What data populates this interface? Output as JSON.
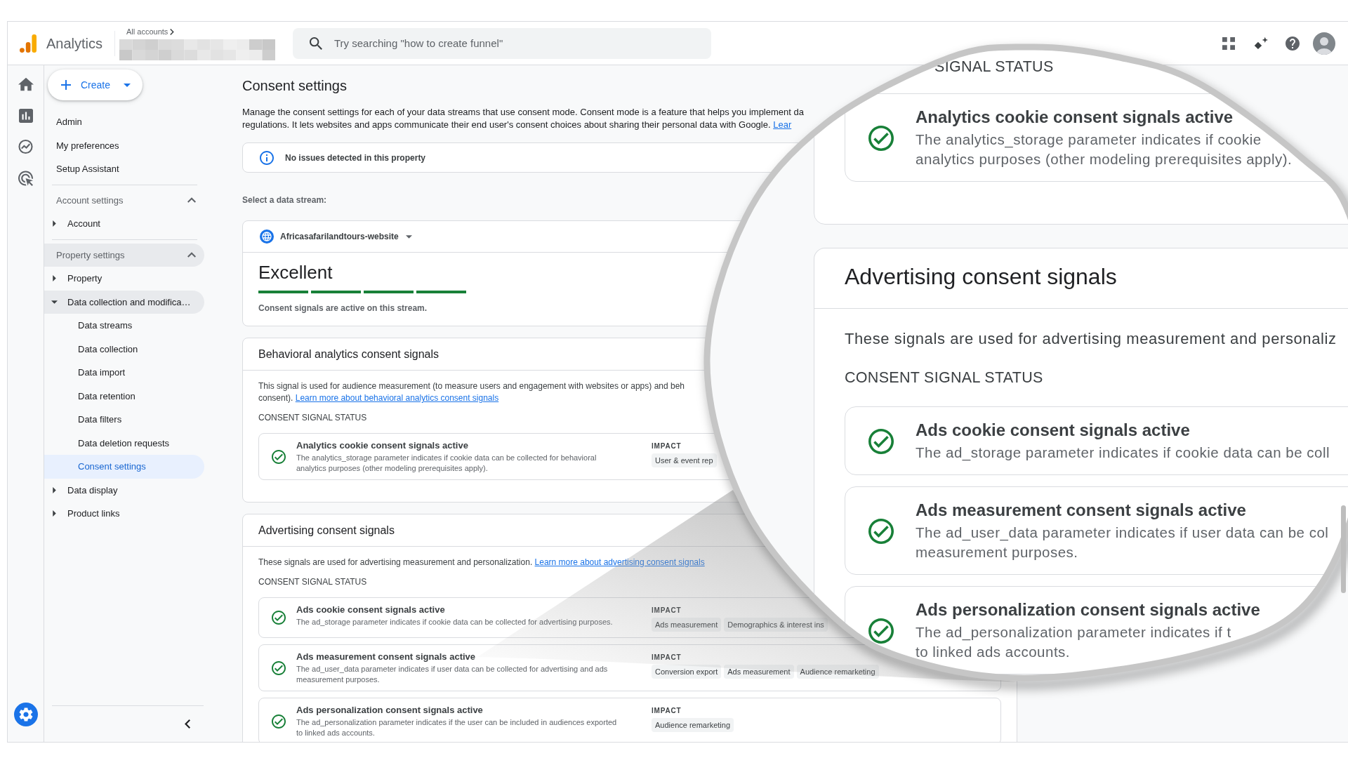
{
  "header": {
    "product_name": "Analytics",
    "breadcrumb": "All accounts",
    "search": {
      "placeholder": "Try searching \"how to create funnel\""
    }
  },
  "sidebar": {
    "create_button": "Create",
    "links": [
      {
        "label": "Admin",
        "selected": false
      },
      {
        "label": "My preferences",
        "selected": false
      },
      {
        "label": "Setup Assistant",
        "selected": false
      }
    ],
    "sections": [
      {
        "label": "Account settings",
        "expanded": true,
        "highlighted": false,
        "items": [
          {
            "label": "Account",
            "expanded": false,
            "highlighted": false,
            "selected": false
          }
        ]
      },
      {
        "label": "Property settings",
        "expanded": true,
        "highlighted": true,
        "items": [
          {
            "label": "Property",
            "expanded": false,
            "highlighted": false,
            "selected": false
          },
          {
            "label": "Data collection and modifica…",
            "expanded": true,
            "highlighted": true,
            "selected": false,
            "children": [
              {
                "label": "Data streams",
                "selected": false
              },
              {
                "label": "Data collection",
                "selected": false
              },
              {
                "label": "Data import",
                "selected": false
              },
              {
                "label": "Data retention",
                "selected": false
              },
              {
                "label": "Data filters",
                "selected": false
              },
              {
                "label": "Data deletion requests",
                "selected": false
              },
              {
                "label": "Consent settings",
                "selected": true
              }
            ]
          },
          {
            "label": "Data display",
            "expanded": false,
            "highlighted": false,
            "selected": false
          },
          {
            "label": "Product links",
            "expanded": false,
            "highlighted": false,
            "selected": false
          }
        ]
      }
    ]
  },
  "page": {
    "title": "Consent settings",
    "description": {
      "lines": [
        "Manage the consent settings for each of your data streams that use consent mode. Consent mode is a feature that helps you implement da",
        "regulations. It lets websites and apps communicate their end user's consent choices about sharing their personal data with Google."
      ],
      "link": "Lear"
    },
    "notice": {
      "kind": "info",
      "text": "No issues detected in this property"
    },
    "stream_select": {
      "label": "Select a data stream:",
      "stream": "Africasafarilandtours-website",
      "rating": "Excellent",
      "level": 1,
      "status_text": "Consent signals are active on this stream."
    },
    "sections": [
      {
        "title": "Behavioral analytics consent signals",
        "description": {
          "lines": [
            "This signal is used for audience measurement (to measure users and engagement with websites or apps) and beh",
            "consent)."
          ],
          "link": "Learn more about behavioral analytics consent signals"
        },
        "status_heading": "CONSENT SIGNAL STATUS",
        "signals": [
          {
            "active": true,
            "title": "Analytics cookie consent signals active",
            "description": "The analytics_storage parameter indicates if cookie data can be collected for behavioral analytics purposes (other modeling prerequisites apply).",
            "impact_label": "IMPACT",
            "impacts": [
              "User & event rep"
            ]
          }
        ]
      },
      {
        "title": "Advertising consent signals",
        "description": {
          "lines": [
            "These signals are used for advertising measurement and personalization."
          ],
          "link": "Learn more about advertising consent signals"
        },
        "status_heading": "CONSENT SIGNAL STATUS",
        "signals": [
          {
            "active": true,
            "title": "Ads cookie consent signals active",
            "description": "The ad_storage parameter indicates if cookie data can be collected for advertising purposes.",
            "impact_label": "IMPACT",
            "impacts": [
              "Ads measurement",
              "Demographics & interest ins"
            ]
          },
          {
            "active": true,
            "title": "Ads measurement consent signals active",
            "description": "The ad_user_data parameter indicates if user data can be collected for advertising and ads measurement purposes.",
            "impact_label": "IMPACT",
            "impacts": [
              "Conversion export",
              "Ads measurement",
              "Audience remarketing"
            ]
          },
          {
            "active": true,
            "title": "Ads personalization consent signals active",
            "description": "The ad_personalization parameter indicates if the user can be included in audiences exported to linked ads accounts.",
            "impact_label": "IMPACT",
            "impacts": [
              "Audience remarketing"
            ]
          }
        ]
      }
    ]
  },
  "magnifier": {
    "behavioral": {
      "status_heading": "SIGNAL STATUS",
      "signals": [
        {
          "active": true,
          "title": "Analytics cookie consent signals active",
          "description_lines": [
            "The analytics_storage parameter indicates if cookie",
            "analytics purposes (other modeling prerequisites apply)."
          ]
        }
      ]
    },
    "advertising": {
      "title": "Advertising consent signals",
      "description": "These signals are used for advertising measurement and personaliz",
      "status_heading": "CONSENT SIGNAL STATUS",
      "signals": [
        {
          "active": true,
          "title": "Ads cookie consent signals active",
          "description_lines": [
            "The ad_storage parameter indicates if cookie data can be coll"
          ]
        },
        {
          "active": true,
          "title": "Ads measurement consent signals active",
          "description_lines": [
            "The ad_user_data parameter indicates if user data can be col",
            "measurement purposes."
          ]
        },
        {
          "active": true,
          "title": "Ads personalization consent signals active",
          "description_lines": [
            "The ad_personalization parameter indicates if t",
            "to linked ads accounts."
          ]
        }
      ]
    }
  }
}
